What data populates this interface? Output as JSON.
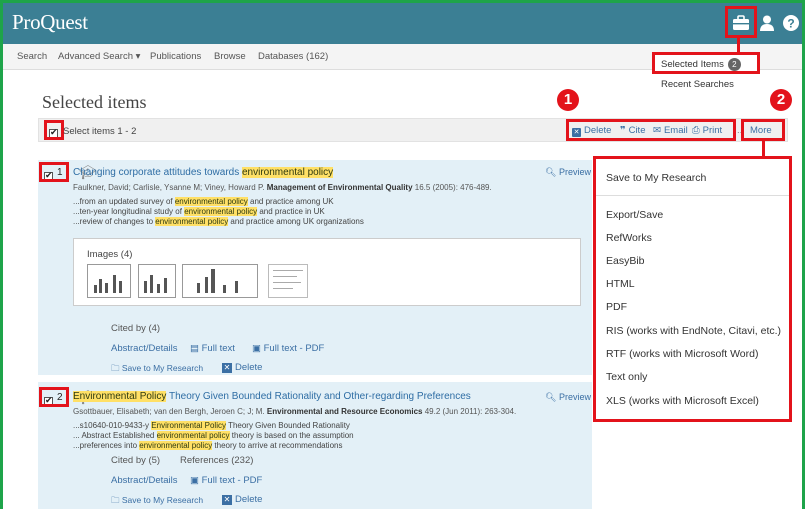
{
  "app": {
    "logo": "ProQuest"
  },
  "nav": {
    "search": "Search",
    "advanced": "Advanced Search ▾",
    "publications": "Publications",
    "browse": "Browse",
    "databases": "Databases (162)"
  },
  "menu": {
    "selected_items": "Selected Items",
    "selected_count": "2",
    "recent": "Recent Searches"
  },
  "page": {
    "title": "Selected items",
    "select_label": "Select items 1 - 2"
  },
  "actions": {
    "delete": "Delete",
    "cite": "Cite",
    "email": "Email",
    "print": "Print",
    "more": "More",
    "separator": "..."
  },
  "callouts": {
    "one": "1",
    "two": "2"
  },
  "results": [
    {
      "num": "1",
      "title_pre": "Changing corporate attitudes towards ",
      "title_hl": "environmental policy",
      "title_post": "",
      "meta_pre": "Faulkner, David; Carlisle, Ysanne M; Viney, Howard P. ",
      "meta_journal": "Management of Environmental Quality",
      "meta_post": " 16.5  (2005): 476-489.",
      "snippets": [
        {
          "pre": "...from an updated survey of ",
          "hl": "environmental policy",
          "post": " and practice among UK"
        },
        {
          "pre": "...ten-year longitudinal study of ",
          "hl": "environmental policy",
          "post": " and practice in UK"
        },
        {
          "pre": "...review of changes to ",
          "hl": "environmental policy",
          "post": " and practice among UK organizations"
        }
      ],
      "preview": "Preview",
      "images_label": "Images (4)",
      "cited": "Cited by (4)",
      "abstract": "Abstract/Details",
      "fulltext": "Full text",
      "fulltext_pdf": "Full text - PDF",
      "save": "Save to My Research",
      "delete": "Delete"
    },
    {
      "num": "2",
      "title_pre": "",
      "title_hl": "Environmental Policy",
      "title_post": " Theory Given Bounded Rationality and Other-regarding Preferences",
      "meta_pre": "Gsottbauer, Elisabeth; van den Bergh, Jeroen C; J; M. ",
      "meta_journal": "Environmental and Resource Economics",
      "meta_post": " 49.2  (Jun 2011): 263-304.",
      "snippets": [
        {
          "pre": "...s10640-010-9433-y ",
          "hl": "Environmental Policy",
          "post": " Theory Given Bounded Rationality"
        },
        {
          "pre": "... Abstract Established ",
          "hl": "environmental policy",
          "post": " theory is based on the assumption"
        },
        {
          "pre": "...preferences into ",
          "hl": "environmental policy",
          "post": " theory to arrive at recommendations"
        }
      ],
      "preview": "Preview",
      "cited": "Cited by (5)",
      "references": "References (232)",
      "abstract": "Abstract/Details",
      "fulltext_pdf": "Full text - PDF",
      "save": "Save to My Research",
      "delete": "Delete"
    }
  ],
  "dropdown": {
    "items": [
      "Save to My Research",
      "Export/Save",
      "RefWorks",
      "EasyBib",
      "HTML",
      "PDF",
      "RIS (works with EndNote, Citavi, etc.)",
      "RTF (works with Microsoft Word)",
      "Text only",
      "XLS (works with Microsoft Excel)"
    ]
  },
  "colors": {
    "header": "#3b7f94",
    "highlight": "#e3131b",
    "result_bg": "#e3f0f7",
    "link": "#3b6fa4"
  }
}
